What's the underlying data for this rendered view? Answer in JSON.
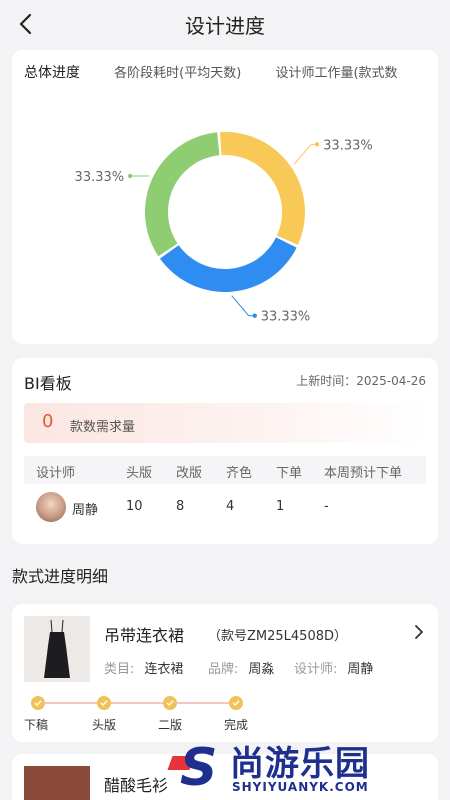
{
  "header": {
    "title": "设计进度"
  },
  "donut_card": {
    "tabs": [
      {
        "label": "总体进度",
        "active": true
      },
      {
        "label": "各阶段耗时(平均天数)",
        "active": false
      },
      {
        "label": "设计师工作量(款式数",
        "active": false
      }
    ]
  },
  "chart_data": {
    "type": "pie",
    "variant": "donut",
    "series": [
      {
        "value": 33.33,
        "label": "33.33%",
        "color": "#f9c957"
      },
      {
        "value": 33.33,
        "label": "33.33%",
        "color": "#2f8df2"
      },
      {
        "value": 33.33,
        "label": "33.33%",
        "color": "#8fcd72"
      }
    ]
  },
  "bi": {
    "title": "BI看板",
    "update_label": "上新时间：",
    "update_date": "2025-04-26",
    "demand_count": "0",
    "demand_label": "款数需求量",
    "columns": [
      "设计师",
      "头版",
      "改版",
      "齐色",
      "下单",
      "本周预计下单"
    ],
    "rows": [
      {
        "designer": "周静",
        "first": "10",
        "revise": "8",
        "color": "4",
        "order": "1",
        "weekly": "-"
      }
    ]
  },
  "detail": {
    "section_title": "款式进度明细",
    "items": [
      {
        "name": "吊带连衣裙",
        "code": "（款号ZM25L4508D）",
        "category_label": "类目:",
        "category": "连衣裙",
        "brand_label": "品牌:",
        "brand": "周淼",
        "designer_label": "设计师:",
        "designer": "周静",
        "steps": [
          "下稿",
          "头版",
          "二版",
          "完成"
        ]
      },
      {
        "name": "醋酸毛衫"
      }
    ]
  },
  "watermark": {
    "brand": "尚游乐园",
    "url": "SHYIYUANYK.COM"
  },
  "colors": {
    "accent": "#e35b2d",
    "step": "#f1c256",
    "watermark": "#1e2f8e"
  }
}
